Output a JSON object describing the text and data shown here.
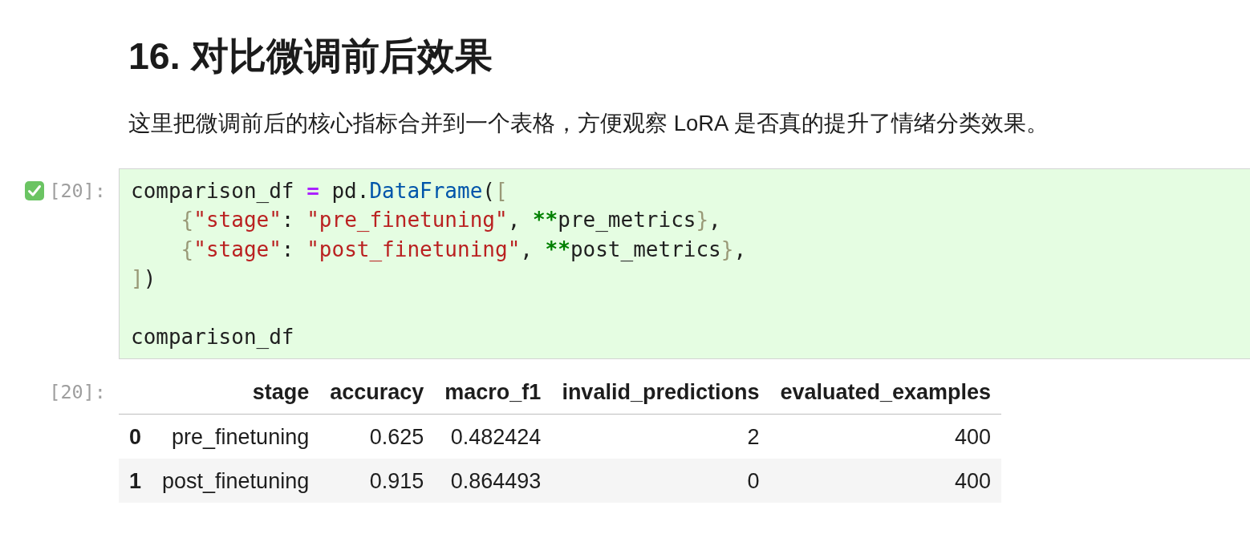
{
  "heading": "16. 对比微调前后效果",
  "intro": "这里把微调前后的核心指标合并到一个表格，方便观察 LoRA 是否真的提升了情绪分类效果。",
  "code_cell": {
    "succeeded": true,
    "prompt": "[20]:",
    "lines": [
      {
        "kind": "code",
        "tokens": [
          {
            "text": "comparison_df ",
            "kind": "plain"
          },
          {
            "text": "=",
            "kind": "operator"
          },
          {
            "text": " pd.",
            "kind": "plain"
          },
          {
            "text": "DataFrame",
            "kind": "property"
          },
          {
            "text": "(",
            "kind": "plain"
          },
          {
            "text": "[",
            "kind": "bracket"
          }
        ]
      },
      {
        "kind": "code",
        "tokens": [
          {
            "text": "    {",
            "kind": "bracket"
          },
          {
            "text": "\"stage\"",
            "kind": "string"
          },
          {
            "text": ": ",
            "kind": "plain"
          },
          {
            "text": "\"pre_finetuning\"",
            "kind": "string"
          },
          {
            "text": ", ",
            "kind": "plain"
          },
          {
            "text": "**",
            "kind": "unpack"
          },
          {
            "text": "pre_metrics",
            "kind": "plain"
          },
          {
            "text": "}",
            "kind": "bracket"
          },
          {
            "text": ",",
            "kind": "plain"
          }
        ]
      },
      {
        "kind": "code",
        "tokens": [
          {
            "text": "    {",
            "kind": "bracket"
          },
          {
            "text": "\"stage\"",
            "kind": "string"
          },
          {
            "text": ": ",
            "kind": "plain"
          },
          {
            "text": "\"post_finetuning\"",
            "kind": "string"
          },
          {
            "text": ", ",
            "kind": "plain"
          },
          {
            "text": "**",
            "kind": "unpack"
          },
          {
            "text": "post_metrics",
            "kind": "plain"
          },
          {
            "text": "}",
            "kind": "bracket"
          },
          {
            "text": ",",
            "kind": "plain"
          }
        ]
      },
      {
        "kind": "code",
        "tokens": [
          {
            "text": "]",
            "kind": "bracket"
          },
          {
            "text": ")",
            "kind": "plain"
          }
        ]
      },
      {
        "kind": "blank"
      },
      {
        "kind": "code",
        "tokens": [
          {
            "text": "comparison_df",
            "kind": "plain"
          }
        ]
      }
    ]
  },
  "output": {
    "prompt": "[20]:",
    "table": {
      "columns": [
        "stage",
        "accuracy",
        "macro_f1",
        "invalid_predictions",
        "evaluated_examples"
      ],
      "rows": [
        {
          "index": "0",
          "cells": [
            "pre_finetuning",
            "0.625",
            "0.482424",
            "2",
            "400"
          ]
        },
        {
          "index": "1",
          "cells": [
            "post_finetuning",
            "0.915",
            "0.864493",
            "0",
            "400"
          ]
        }
      ]
    }
  }
}
